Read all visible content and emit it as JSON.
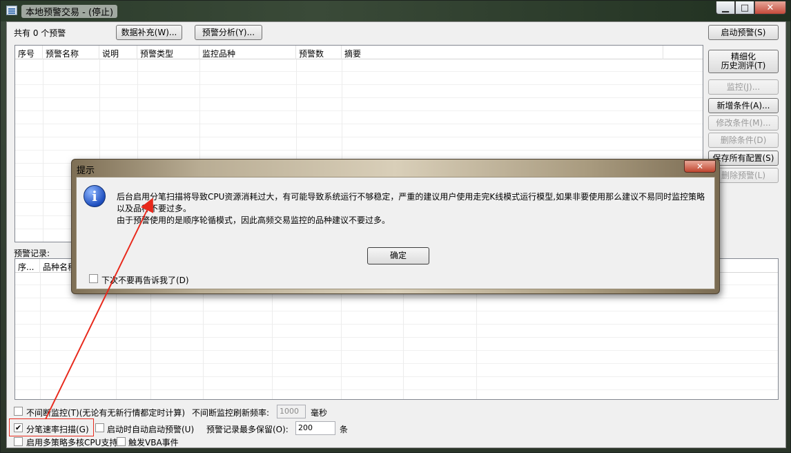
{
  "window": {
    "title": "本地预警交易 - (停止)",
    "minimize": "▁",
    "maximize": "□",
    "close": "✕"
  },
  "toolbar": {
    "count_label": "共有 0 个预警",
    "data_fill_button": "数据补充(W)...",
    "analysis_button": "预警分析(Y)..."
  },
  "alert_table": {
    "columns": [
      "序号",
      "预警名称",
      "说明",
      "预警类型",
      "监控品种",
      "预警数",
      "摘要"
    ]
  },
  "right_panel": {
    "start_button": "启动预警(S)",
    "backtest_button_line1": "精细化",
    "backtest_button_line2": "历史测评(T)",
    "monitor_button": "监控(J)...",
    "add_condition_button": "新增条件(A)...",
    "edit_condition_button": "修改条件(M)...",
    "delete_condition_button": "删除条件(D)",
    "save_config_button": "保存所有配置(S)",
    "delete_alert_button": "删除预警(L)"
  },
  "records": {
    "label": "预警记录:",
    "columns": [
      "序...",
      "品种名称"
    ]
  },
  "bottom": {
    "continuous_monitor_label": "不间断监控(T)(无论有无新行情都定时计算)",
    "refresh_rate_label": "不间断监控刷新频率:",
    "refresh_rate_value": "1000",
    "refresh_rate_unit": "毫秒",
    "tick_scan_label": "分笔速率扫描(G)",
    "tick_scan_checked": "✔",
    "auto_start_label": "启动时自动启动预警(U)",
    "max_records_label": "预警记录最多保留(O):",
    "max_records_value": "200",
    "max_records_unit": "条",
    "multicore_label": "启用多策略多核CPU支持",
    "vba_event_label": "触发VBA事件"
  },
  "dialog": {
    "title": "提示",
    "close": "✕",
    "icon": "info-icon",
    "icon_glyph": "i",
    "message_line1": "后台启用分笔扫描将导致CPU资源消耗过大，有可能导致系统运行不够稳定，严重的建议用户使用走完K线模式运行模型,如果非要使用那么建议不易同时监控策略",
    "message_line2": "以及品种不要过多。",
    "message_line3": "由于预警使用的是顺序轮循模式，因此高频交易监控的品种建议不要过多。",
    "ok_button": "确定",
    "dont_show_label": "下次不要再告诉我了(D)"
  },
  "annotation": {
    "color": "#e8291c"
  }
}
